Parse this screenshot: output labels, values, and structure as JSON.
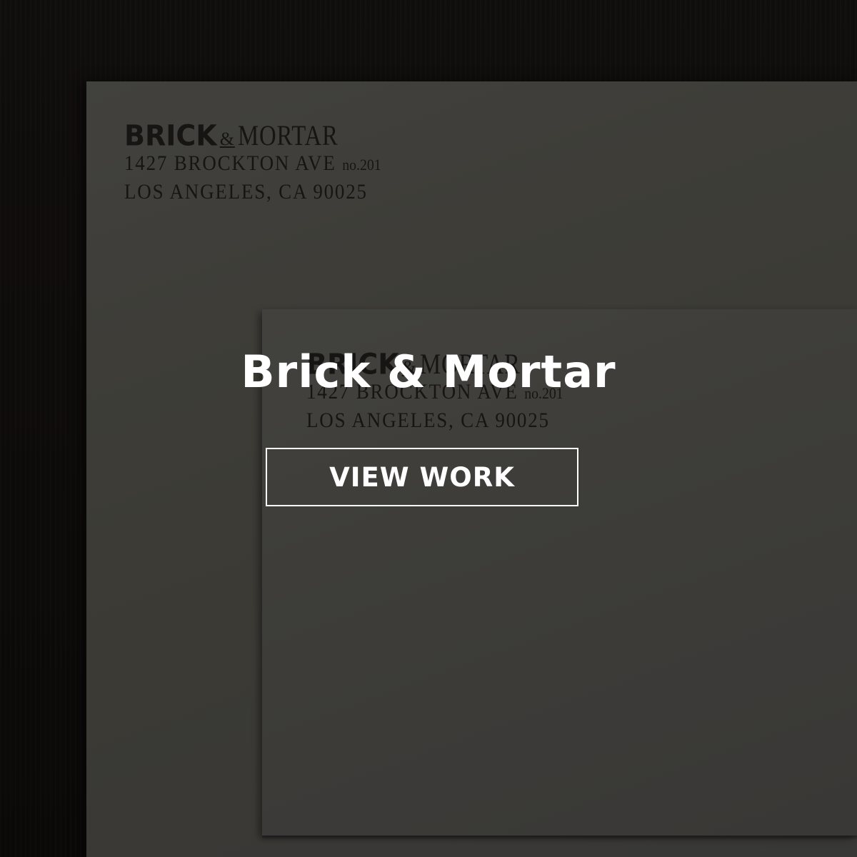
{
  "project": {
    "title": "Brick & Mortar",
    "cta_label": "VIEW WORK"
  },
  "stationery": {
    "logo_brick": "BRICK",
    "logo_amp": "&",
    "logo_mortar": "MORTAR",
    "address_line1": "1427 BROCKTON AVE",
    "address_suite": "no.201",
    "address_line2": "LOS ANGELES, CA 90025"
  },
  "colors": {
    "text": "#ffffff",
    "paper": "#4a4945",
    "background": "#0e0c0b"
  }
}
